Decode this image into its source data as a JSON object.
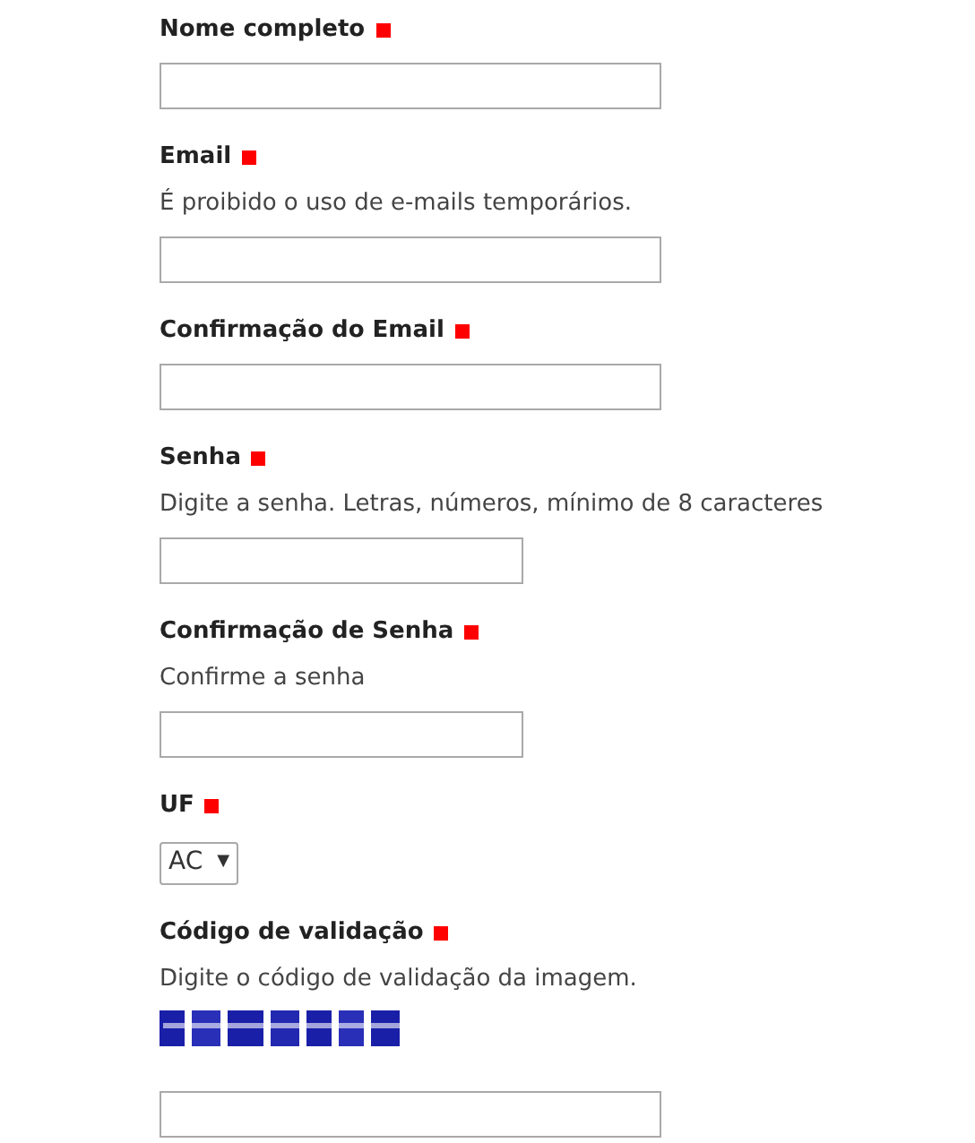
{
  "fields": [
    {
      "label": "Nome completo",
      "required": true,
      "kind": "text"
    },
    {
      "label": "Email",
      "required": true,
      "help": "É proibido o uso de e-mails temporários.",
      "kind": "text"
    },
    {
      "label": "Confirmação do Email",
      "required": true,
      "kind": "text"
    },
    {
      "label": "Senha",
      "required": true,
      "help": "Digite a senha. Letras, números, mínimo de 8 caracteres",
      "kind": "password"
    },
    {
      "label": "Confirmação de Senha",
      "required": true,
      "help": "Confirme a senha",
      "kind": "password"
    },
    {
      "label": "UF",
      "required": true,
      "kind": "select",
      "value": "AC",
      "arrow": "▼"
    },
    {
      "label": "Código de validação",
      "required": true,
      "help": "Digite o código de validação da imagem.",
      "kind": "captcha"
    }
  ]
}
